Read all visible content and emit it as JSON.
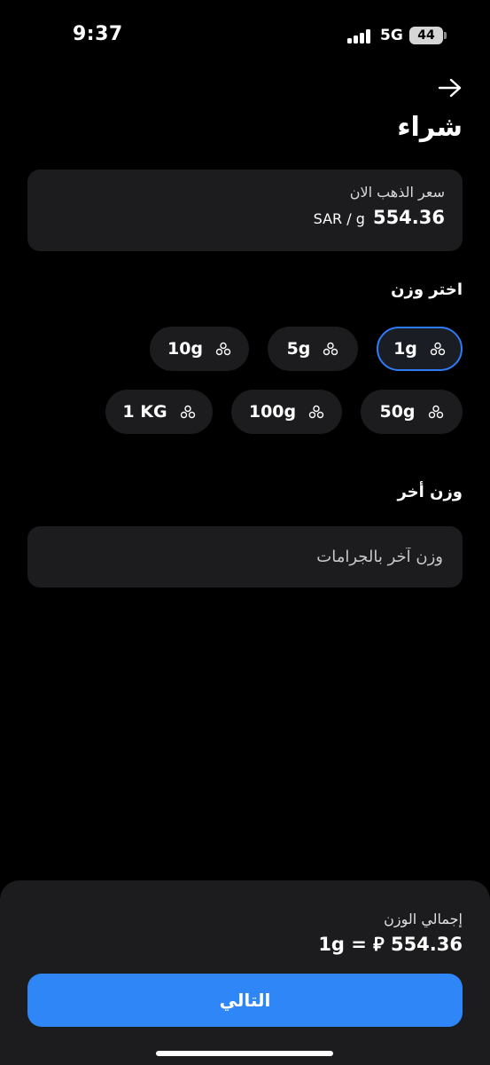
{
  "status_bar": {
    "time": "9:37",
    "network": "5G",
    "battery": "44"
  },
  "header": {
    "back_icon": "arrow-right-icon",
    "title": "شراء"
  },
  "price_card": {
    "label": "سعر الذهب الان",
    "unit": "SAR / g",
    "value": "554.36"
  },
  "weight_selection": {
    "title": "اختر وزن",
    "chip_icon": "gold-bars-icon",
    "options": [
      {
        "label": "1g",
        "selected": true
      },
      {
        "label": "5g",
        "selected": false
      },
      {
        "label": "10g",
        "selected": false
      },
      {
        "label": "50g",
        "selected": false
      },
      {
        "label": "100g",
        "selected": false
      },
      {
        "label": "1 KG",
        "selected": false
      }
    ]
  },
  "custom_weight": {
    "title": "وزن أخر",
    "placeholder": "وزن آخر بالجرامات",
    "value": ""
  },
  "summary": {
    "label": "إجمالي الوزن",
    "value": "1g = ⃁ 554.36",
    "weight": "1g",
    "currency_symbol": "⃁",
    "amount": "554.36"
  },
  "actions": {
    "next_label": "التالي"
  },
  "colors": {
    "background": "#000000",
    "card": "#1c1c1e",
    "accent": "#2f86f6",
    "selected_border": "#2f7bf5"
  }
}
